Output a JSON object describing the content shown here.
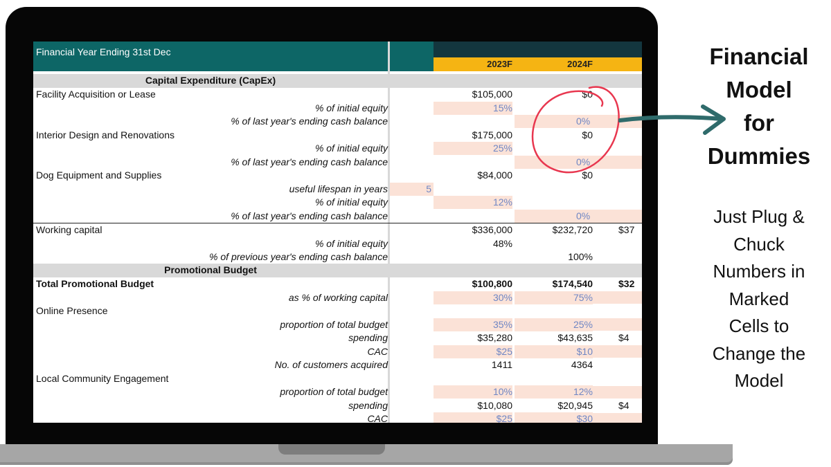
{
  "sheet": {
    "header_title": "Financial Year Ending 31st Dec",
    "years": [
      "2023F",
      "2024F"
    ],
    "capex_title": "Capital Expenditure (CapEx)",
    "promo_title": "Promotional Budget",
    "rows": {
      "facility": {
        "label": "Facility Acquisition or Lease",
        "v1": "$105,000",
        "v2": "$0"
      },
      "facility_eq": {
        "label": "% of initial equity",
        "v1": "15%"
      },
      "facility_cash": {
        "label": "% of last year's ending cash balance",
        "v2": "0%"
      },
      "interior": {
        "label": "Interior Design and Renovations",
        "v1": "$175,000",
        "v2": "$0"
      },
      "interior_eq": {
        "label": "% of initial equity",
        "v1": "25%"
      },
      "interior_cash": {
        "label": "% of last year's ending cash balance",
        "v2": "0%"
      },
      "dog": {
        "label": "Dog Equipment and Supplies",
        "v1": "$84,000",
        "v2": "$0"
      },
      "dog_life": {
        "label": "useful lifespan in years",
        "mid": "5"
      },
      "dog_eq": {
        "label": "% of initial equity",
        "v1": "12%"
      },
      "dog_cash": {
        "label": "% of last year's ending cash balance",
        "v2": "0%"
      },
      "working": {
        "label": "Working capital",
        "v1": "$336,000",
        "v2": "$232,720",
        "v3": "$37"
      },
      "working_eq": {
        "label": "% of initial equity",
        "v1": "48%"
      },
      "working_cash": {
        "label": "% of previous year's ending cash balance",
        "v2": "100%"
      },
      "total_promo": {
        "label": "Total Promotional Budget",
        "v1": "$100,800",
        "v2": "$174,540",
        "v3": "$32"
      },
      "promo_pct": {
        "label": "as % of working capital",
        "v1": "30%",
        "v2": "75%"
      },
      "online": {
        "label": "Online Presence"
      },
      "online_prop": {
        "label": "proportion of total budget",
        "v1": "35%",
        "v2": "25%"
      },
      "online_spend": {
        "label": "spending",
        "v1": "$35,280",
        "v2": "$43,635",
        "v3": "$4"
      },
      "online_cac": {
        "label": "CAC",
        "v1": "$25",
        "v2": "$10"
      },
      "online_cust": {
        "label": "No. of customers acquired",
        "v1": "1411",
        "v2": "4364"
      },
      "local": {
        "label": "Local Community Engagement"
      },
      "local_prop": {
        "label": "proportion of total budget",
        "v1": "10%",
        "v2": "12%"
      },
      "local_spend": {
        "label": "spending",
        "v1": "$10,080",
        "v2": "$20,945",
        "v3": "$4"
      },
      "local_cac": {
        "label": "CAC",
        "v1": "$25",
        "v2": "$30"
      }
    }
  },
  "promo": {
    "title_lines": [
      "Financial",
      "Model",
      "for",
      "Dummies"
    ],
    "subtitle_lines": [
      "Just Plug &",
      "Chuck",
      "Numbers in",
      "Marked",
      "Cells to",
      "Change the",
      "Model"
    ]
  },
  "colors": {
    "header_teal": "#0d6666",
    "header_dark": "#13363e",
    "year_yellow": "#f5b413",
    "input_fill": "#fbe2d7",
    "input_text": "#6f86c4",
    "circle_red": "#e8374f",
    "arrow_teal": "#2f6b6b"
  }
}
